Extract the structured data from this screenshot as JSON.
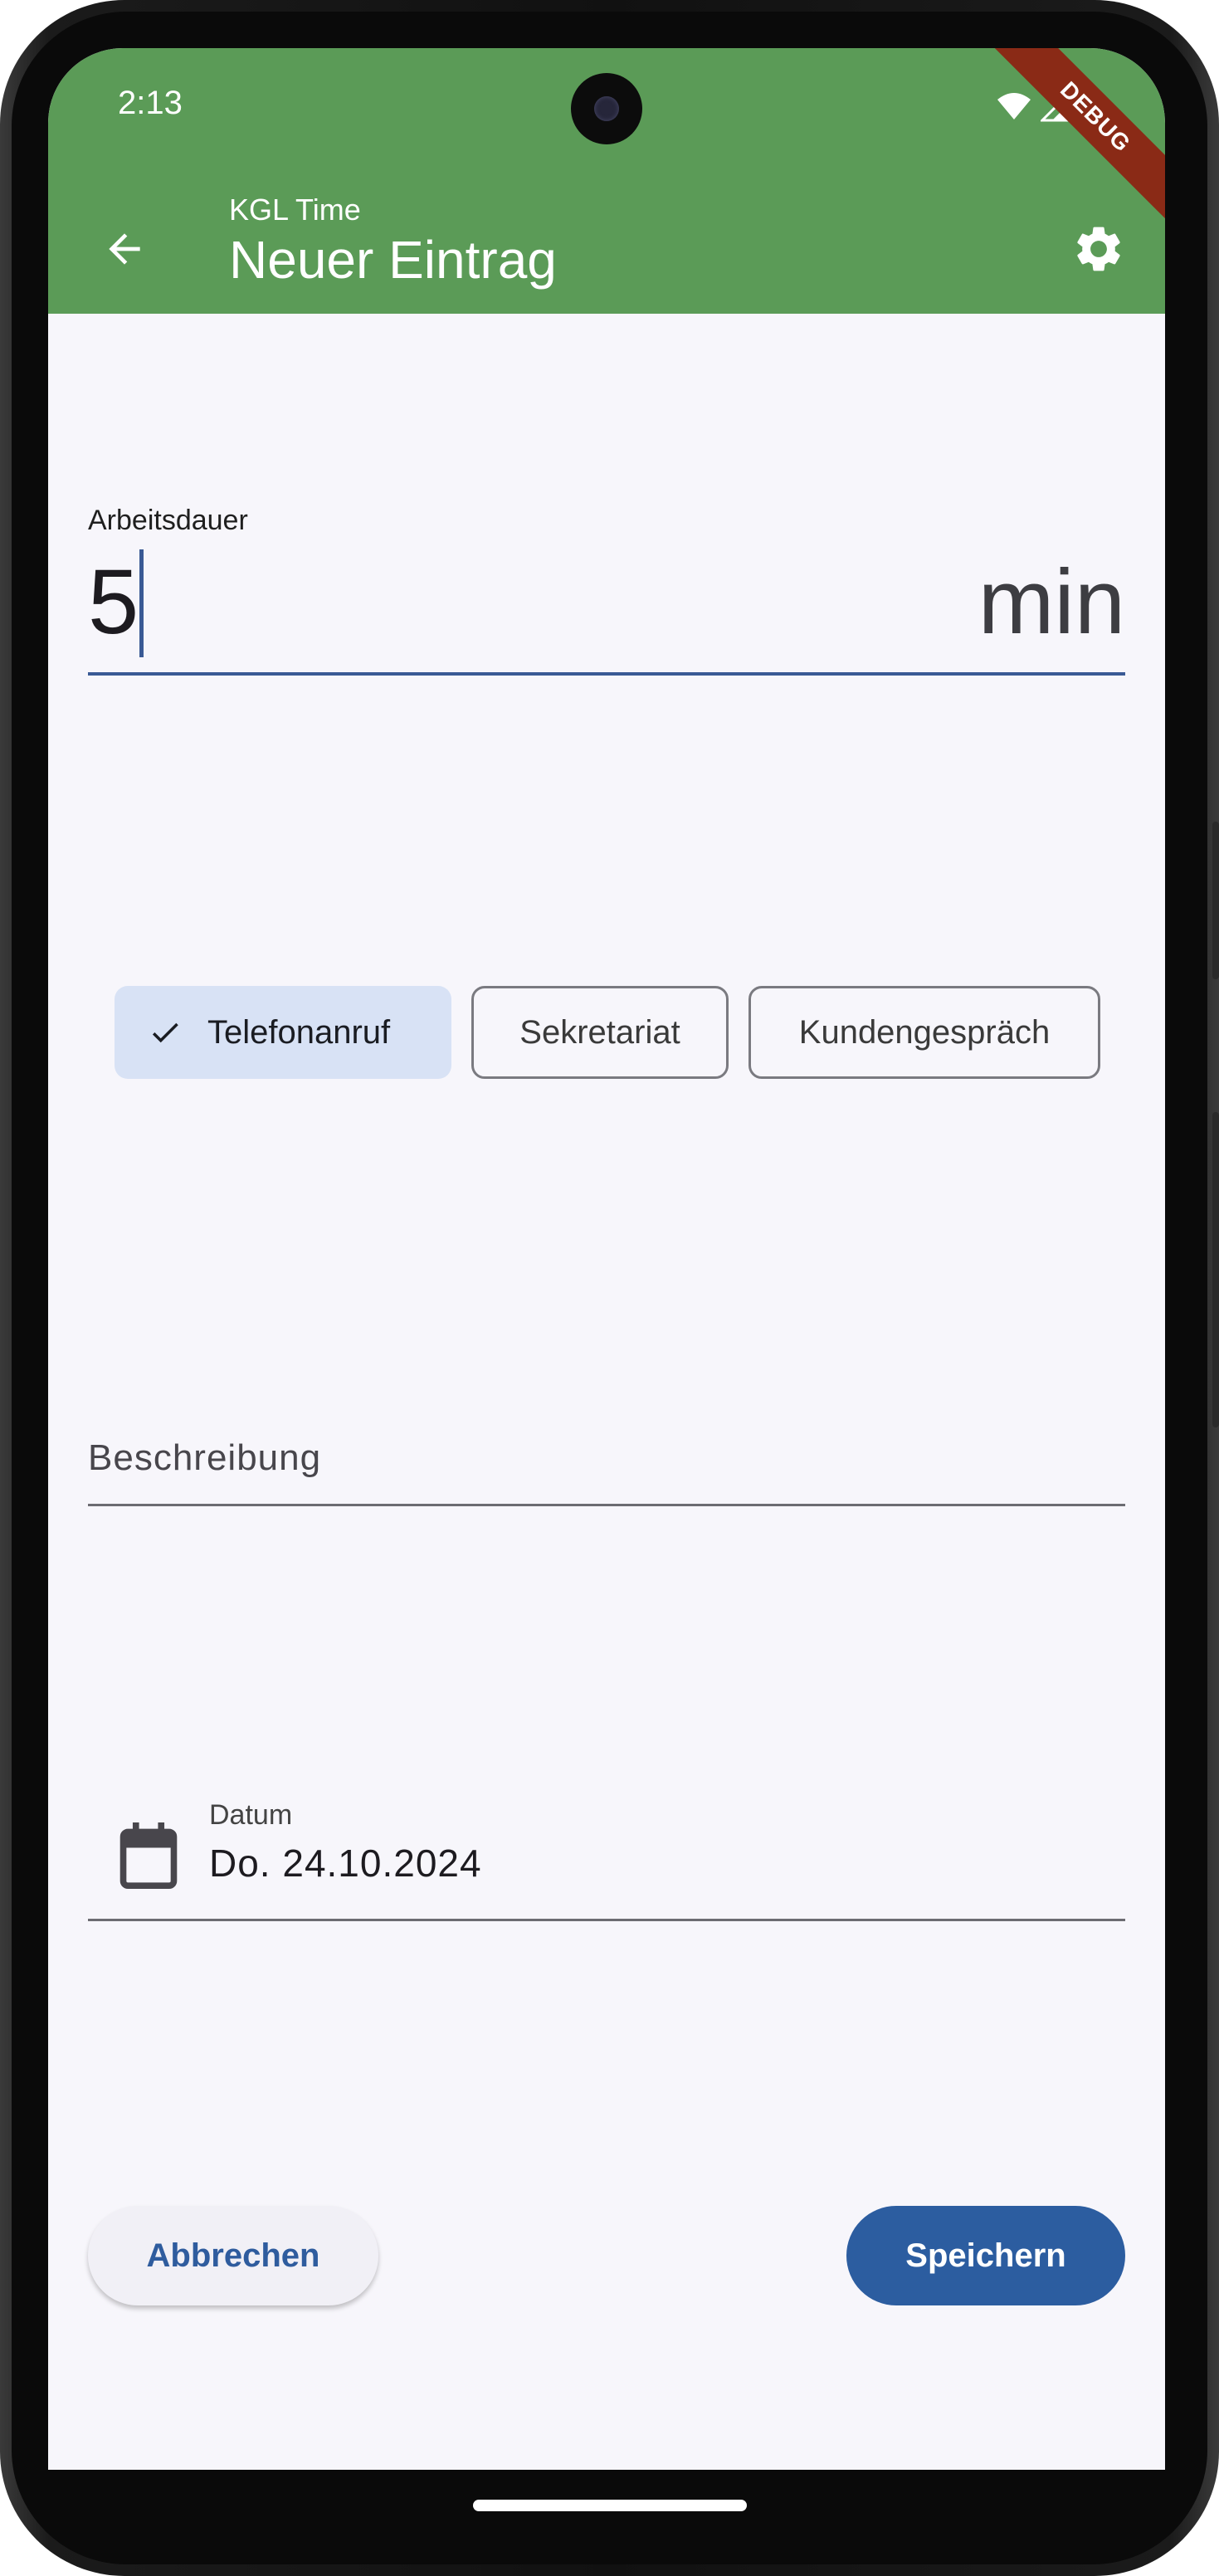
{
  "status_bar": {
    "time": "2:13"
  },
  "debug_banner": "DEBUG",
  "app_bar": {
    "app_name": "KGL Time",
    "title": "Neuer Eintrag",
    "color": "#5b9b57"
  },
  "duration": {
    "label": "Arbeitsdauer",
    "value": "5",
    "unit": "min"
  },
  "categories": [
    {
      "label": "Telefonanruf",
      "selected": true
    },
    {
      "label": "Sekretariat",
      "selected": false
    },
    {
      "label": "Kundengespräch",
      "selected": false
    }
  ],
  "description": {
    "placeholder": "Beschreibung"
  },
  "date": {
    "label": "Datum",
    "value": "Do. 24.10.2024",
    "icon": "calendar-icon"
  },
  "actions": {
    "cancel_label": "Abbrechen",
    "save_label": "Speichern",
    "primary_color": "#2c5da0"
  }
}
